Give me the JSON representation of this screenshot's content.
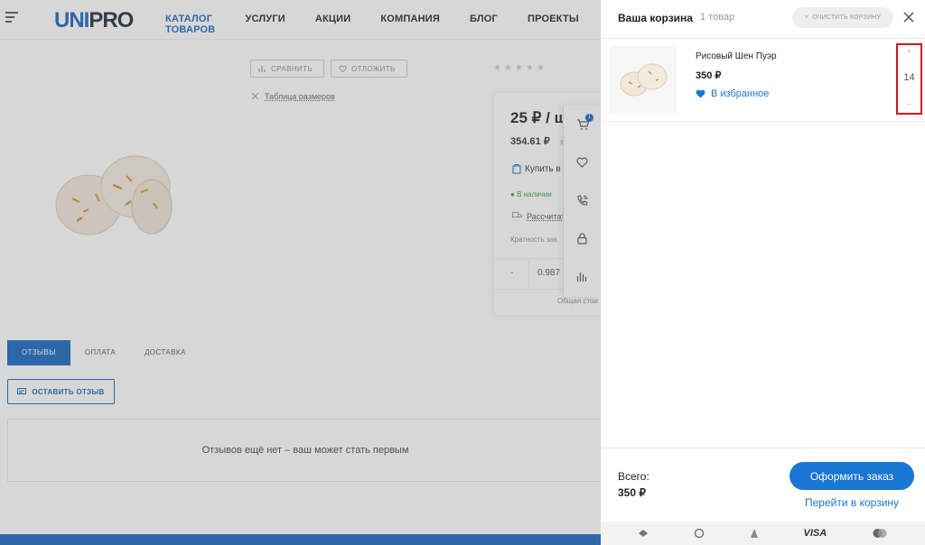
{
  "header": {
    "logo_u": "UNI",
    "logo_pro": "PRO",
    "nav": [
      "КАТАЛОГ ТОВАРОВ",
      "УСЛУГИ",
      "АКЦИИ",
      "КОМПАНИЯ",
      "БЛОГ",
      "ПРОЕКТЫ"
    ]
  },
  "product": {
    "compare_label": "СРАВНИТЬ",
    "postpone_label": "ОТЛОЖИТЬ",
    "sizes_label": "Таблица размеров",
    "price": "25 ₽ / ш",
    "price_alt": "354.61 ₽",
    "price_alt_suffix": "з",
    "buy_label": "Купить в",
    "stock": "В наличии",
    "calc_label": "Рассчитать",
    "multiplicity": "Кратность зак",
    "qty_minus": "-",
    "qty_value": "0.987",
    "total_hint": "Общая стои",
    "rating_stars": "★★★★★"
  },
  "sidebar": {
    "cart_badge": "1"
  },
  "tabs": [
    "ОТЗЫВЫ",
    "ОПЛАТА",
    "ДОСТАВКА"
  ],
  "reviews": {
    "leave_review": "ОСТАВИТЬ ОТЗЫВ",
    "empty": "Отзывов ещё нет – ваш может стать первым"
  },
  "cart": {
    "title": "Ваша корзина",
    "count": "1 товар",
    "clear_label": "ОЧИСТИТЬ КОРЗИНУ",
    "item": {
      "name": "Рисовый Шен Пуэр",
      "price": "350 ₽",
      "favorite": "В избранное",
      "quantity": "14",
      "plus": "+",
      "minus": "–"
    },
    "total_label": "Всего:",
    "total_value": "350 ₽",
    "checkout": "Оформить заказ",
    "go_to_cart": "Перейти в корзину",
    "payments": [
      "visa-label",
      "VISA"
    ]
  },
  "colors": {
    "accent": "#1976d2",
    "brand": "#1565c0",
    "highlight": "#d0161b",
    "stock": "#2e9a47"
  }
}
